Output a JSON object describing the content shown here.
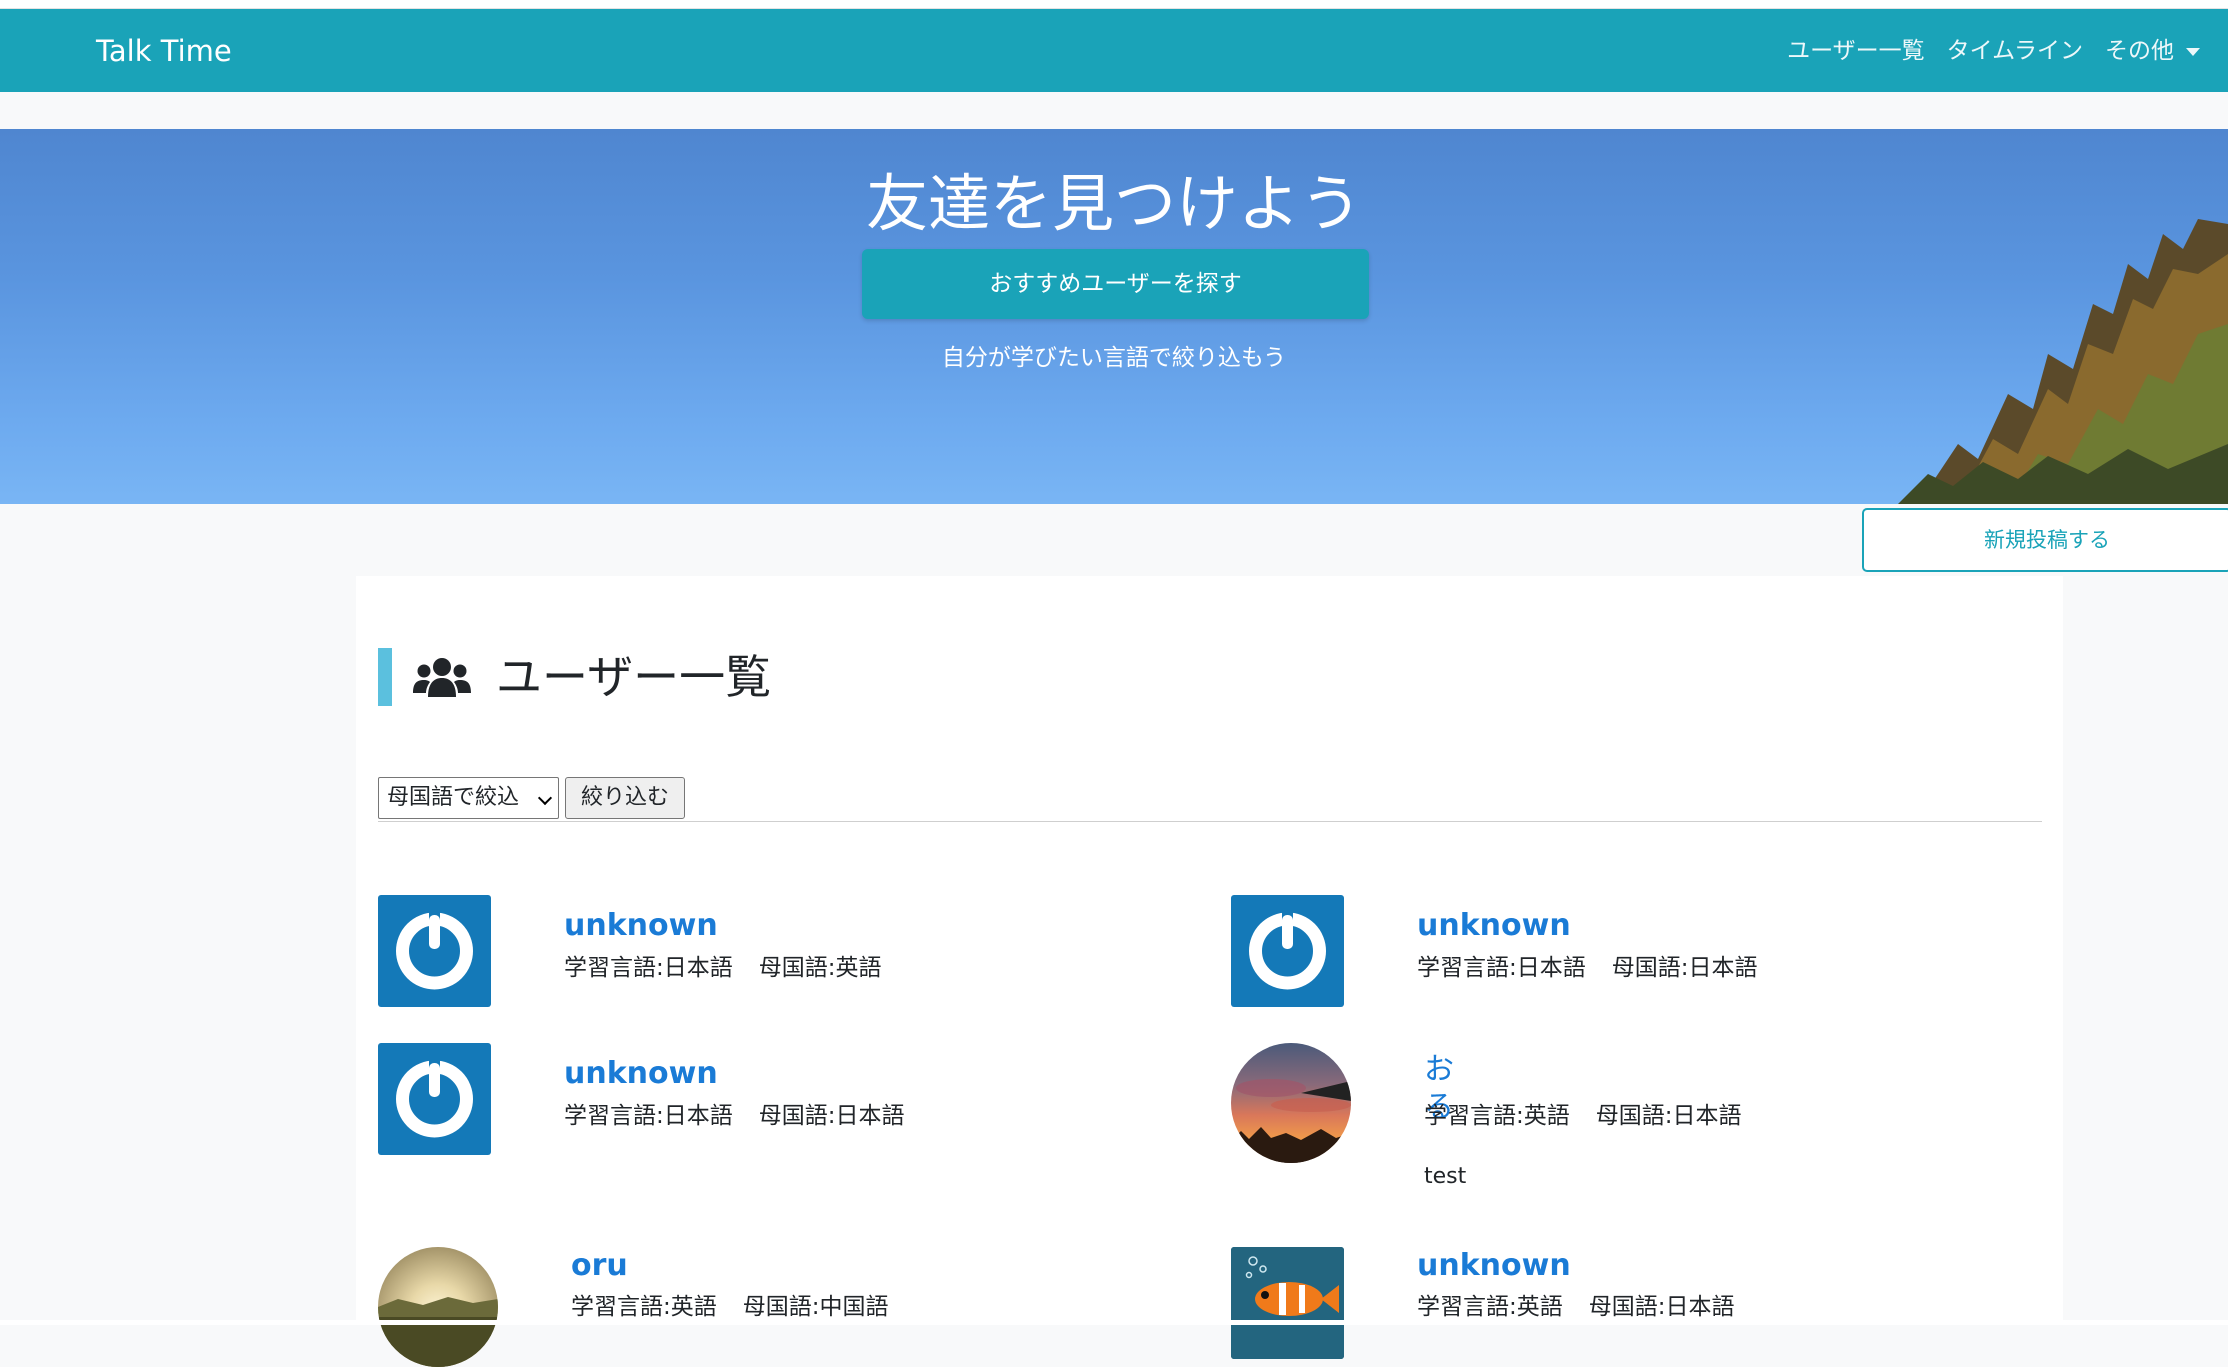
{
  "navbar": {
    "brand": "Talk Time",
    "links": [
      {
        "label": "ユーザー一覧"
      },
      {
        "label": "タイムライン"
      },
      {
        "label": "その他"
      }
    ]
  },
  "hero": {
    "title": "友達を見つけよう",
    "button_label": "おすすめユーザーを探す",
    "subtitle": "自分が学びたい言語で絞り込もう"
  },
  "new_post_button": "新規投稿する",
  "users_section": {
    "title": "ユーザー一覧",
    "filter": {
      "selected": "母国語で絞込",
      "submit_label": "絞り込む"
    },
    "users": [
      {
        "name": "unknown",
        "learning": "学習言語:日本語",
        "native": "母国語:英語",
        "avatar": "default-power-icon"
      },
      {
        "name": "unknown",
        "learning": "学習言語:日本語",
        "native": "母国語:日本語",
        "avatar": "default-power-icon"
      },
      {
        "name": "unknown",
        "learning": "学習言語:日本語",
        "native": "母国語:日本語",
        "avatar": "default-power-icon"
      },
      {
        "name": "おる",
        "learning": "学習言語:英語",
        "native": "母国語:日本語",
        "bio": "test",
        "avatar": "sunset-photo"
      },
      {
        "name": "oru",
        "learning": "学習言語:英語",
        "native": "母国語:中国語",
        "avatar": "landscape-photo"
      },
      {
        "name": "unknown",
        "learning": "学習言語:英語",
        "native": "母国語:日本語",
        "avatar": "fish-photo"
      }
    ]
  },
  "colors": {
    "navbar": "#1aa3b8",
    "accent": "#5bc0de",
    "link": "#1a7bd6",
    "default_avatar": "#1479b8"
  }
}
